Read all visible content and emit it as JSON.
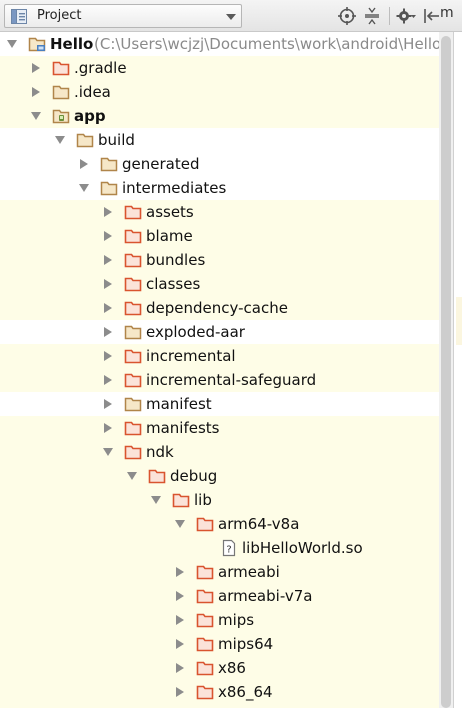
{
  "toolbar": {
    "view_label": "Project",
    "icons": [
      "project-view-icon",
      "chevron-down-icon",
      "locate-icon",
      "collapse-all-icon",
      "gear-icon",
      "hide-panel-icon"
    ],
    "cut_text": "m"
  },
  "tree": {
    "rows": [
      {
        "label": "Hello",
        "note": " (C:\\Users\\wcjzj\\Documents\\work\\android\\Hello",
        "depth": 0,
        "arrow": "down",
        "icon": "module-root",
        "bold": true,
        "hl": false
      },
      {
        "label": ".gradle",
        "depth": 1,
        "arrow": "right",
        "icon": "folder-excluded",
        "hl": true
      },
      {
        "label": ".idea",
        "depth": 1,
        "arrow": "right",
        "icon": "folder",
        "hl": true
      },
      {
        "label": "app",
        "depth": 1,
        "arrow": "down",
        "icon": "folder-module",
        "bold": true,
        "hl": true
      },
      {
        "label": "build",
        "depth": 2,
        "arrow": "down",
        "icon": "folder",
        "hl": false
      },
      {
        "label": "generated",
        "depth": 3,
        "arrow": "right",
        "icon": "folder",
        "hl": false
      },
      {
        "label": "intermediates",
        "depth": 3,
        "arrow": "down",
        "icon": "folder",
        "hl": false
      },
      {
        "label": "assets",
        "depth": 4,
        "arrow": "right",
        "icon": "folder-excluded",
        "hl": true
      },
      {
        "label": "blame",
        "depth": 4,
        "arrow": "right",
        "icon": "folder-excluded",
        "hl": true
      },
      {
        "label": "bundles",
        "depth": 4,
        "arrow": "right",
        "icon": "folder-excluded",
        "hl": true
      },
      {
        "label": "classes",
        "depth": 4,
        "arrow": "right",
        "icon": "folder-excluded",
        "hl": true
      },
      {
        "label": "dependency-cache",
        "depth": 4,
        "arrow": "right",
        "icon": "folder-excluded",
        "hl": true
      },
      {
        "label": "exploded-aar",
        "depth": 4,
        "arrow": "right",
        "icon": "folder",
        "hl": false
      },
      {
        "label": "incremental",
        "depth": 4,
        "arrow": "right",
        "icon": "folder-excluded",
        "hl": true
      },
      {
        "label": "incremental-safeguard",
        "depth": 4,
        "arrow": "right",
        "icon": "folder-excluded",
        "hl": true
      },
      {
        "label": "manifest",
        "depth": 4,
        "arrow": "right",
        "icon": "folder",
        "hl": false
      },
      {
        "label": "manifests",
        "depth": 4,
        "arrow": "right",
        "icon": "folder-excluded",
        "hl": true
      },
      {
        "label": "ndk",
        "depth": 4,
        "arrow": "down",
        "icon": "folder-excluded",
        "hl": true
      },
      {
        "label": "debug",
        "depth": 5,
        "arrow": "down",
        "icon": "folder-excluded",
        "hl": true
      },
      {
        "label": "lib",
        "depth": 6,
        "arrow": "down",
        "icon": "folder-excluded",
        "hl": true
      },
      {
        "label": "arm64-v8a",
        "depth": 7,
        "arrow": "down",
        "icon": "folder-excluded",
        "hl": true
      },
      {
        "label": "libHelloWorld.so",
        "depth": 8,
        "arrow": "none",
        "icon": "file-unknown",
        "hl": true
      },
      {
        "label": "armeabi",
        "depth": 7,
        "arrow": "right",
        "icon": "folder-excluded",
        "hl": true
      },
      {
        "label": "armeabi-v7a",
        "depth": 7,
        "arrow": "right",
        "icon": "folder-excluded",
        "hl": true
      },
      {
        "label": "mips",
        "depth": 7,
        "arrow": "right",
        "icon": "folder-excluded",
        "hl": true
      },
      {
        "label": "mips64",
        "depth": 7,
        "arrow": "right",
        "icon": "folder-excluded",
        "hl": true
      },
      {
        "label": "x86",
        "depth": 7,
        "arrow": "right",
        "icon": "folder-excluded",
        "hl": true
      },
      {
        "label": "x86_64",
        "depth": 7,
        "arrow": "right",
        "icon": "folder-excluded",
        "hl": true
      },
      {
        "label": "",
        "depth": 5,
        "arrow": "right",
        "icon": "folder-excluded",
        "hl": true
      }
    ]
  },
  "colors": {
    "highlight_row": "#fefde7",
    "excluded_folder": "#d9542f",
    "normal_folder": "#b0854a",
    "path_note": "#8a8a8a"
  }
}
